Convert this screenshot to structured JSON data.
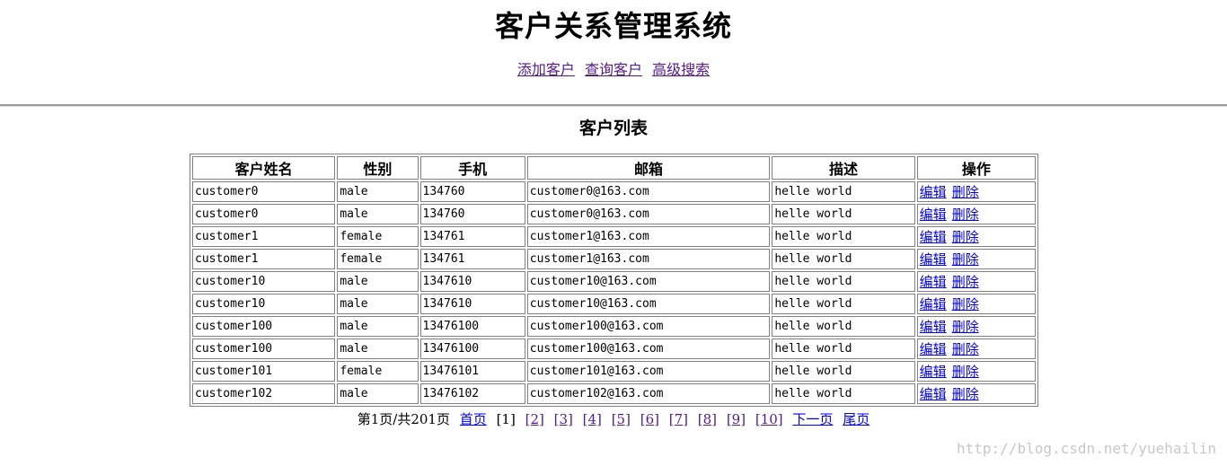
{
  "header": {
    "title": "客户关系管理系统",
    "nav": [
      "添加客户",
      "查询客户",
      "高级搜索"
    ]
  },
  "section_title": "客户列表",
  "table": {
    "columns": [
      "客户姓名",
      "性别",
      "手机",
      "邮箱",
      "描述",
      "操作"
    ],
    "rows": [
      [
        "customer0",
        "male",
        "134760",
        "customer0@163.com",
        "helle world"
      ],
      [
        "customer0",
        "male",
        "134760",
        "customer0@163.com",
        "helle world"
      ],
      [
        "customer1",
        "female",
        "134761",
        "customer1@163.com",
        "helle world"
      ],
      [
        "customer1",
        "female",
        "134761",
        "customer1@163.com",
        "helle world"
      ],
      [
        "customer10",
        "male",
        "1347610",
        "customer10@163.com",
        "helle world"
      ],
      [
        "customer10",
        "male",
        "1347610",
        "customer10@163.com",
        "helle world"
      ],
      [
        "customer100",
        "male",
        "13476100",
        "customer100@163.com",
        "helle world"
      ],
      [
        "customer100",
        "male",
        "13476100",
        "customer100@163.com",
        "helle world"
      ],
      [
        "customer101",
        "female",
        "13476101",
        "customer101@163.com",
        "helle world"
      ],
      [
        "customer102",
        "male",
        "13476102",
        "customer102@163.com",
        "helle world"
      ]
    ],
    "edit_label": "编辑",
    "delete_label": "删除"
  },
  "pager": {
    "info": "第1页/共201页",
    "first": "首页",
    "current": "[1]",
    "pages": [
      "[2]",
      "[3]",
      "[4]",
      "[5]",
      "[6]",
      "[7]",
      "[8]",
      "[9]",
      "[10]"
    ],
    "next": "下一页",
    "last": "尾页"
  },
  "watermark": "http://blog.csdn.net/yuehailin"
}
